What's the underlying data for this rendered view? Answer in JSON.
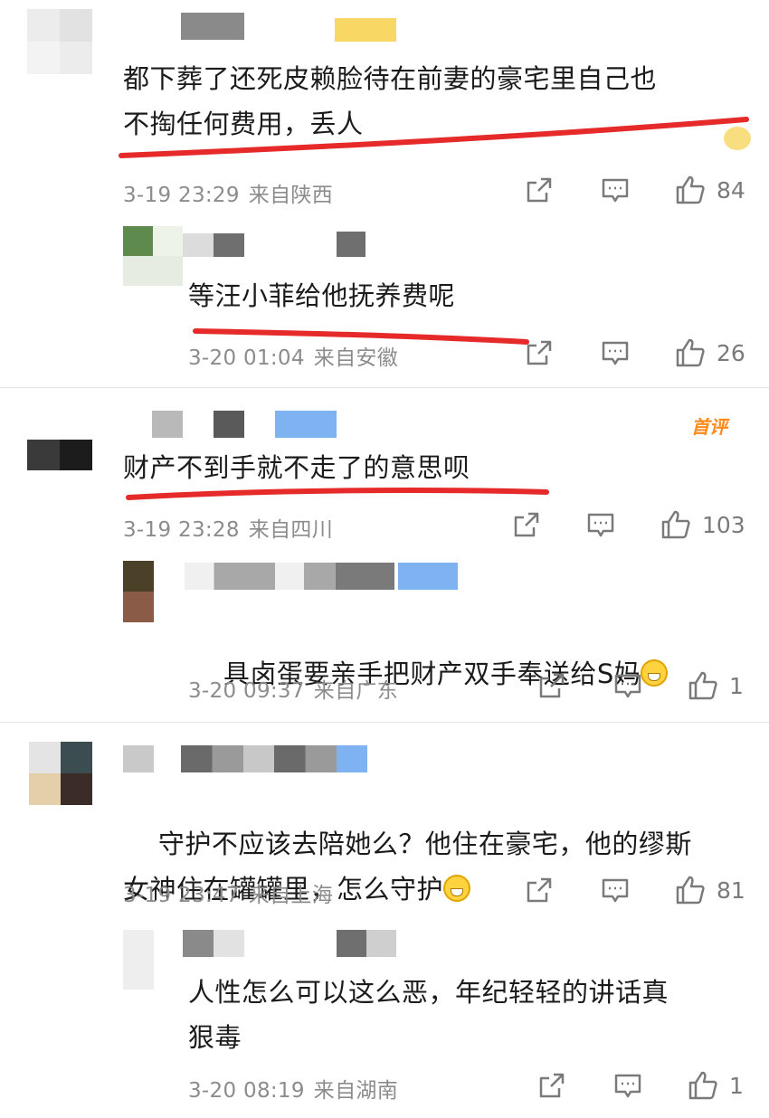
{
  "colors": {
    "underline": "#e62a2a",
    "meta_text": "#8c8c8c",
    "badge": "#ff8a1a",
    "vip_yellow": "#f7d049",
    "blue_name": "#7fb2f0"
  },
  "comments": [
    {
      "text": "都下葬了还死皮赖脸待在前妻的豪宅里自己也\n不掏任何费用，丢人",
      "time": "3-19 23:29",
      "location": "来自陕西",
      "likes": "84",
      "reply": {
        "text": "等汪小菲给他抚养费呢",
        "time": "3-20 01:04",
        "location": "来自安徽",
        "likes": "26"
      }
    },
    {
      "badge": "首评",
      "text": "财产不到手就不走了的意思呗",
      "time": "3-19 23:28",
      "location": "来自四川",
      "likes": "103",
      "reply": {
        "text": "具卤蛋要亲手把财产双手奉送给S妈",
        "time": "3-20 09:37",
        "location": "来自广东",
        "likes": "1"
      }
    },
    {
      "text": "守护不应该去陪她么？他住在豪宅，他的缪斯\n女神住在罐罐里，怎么守护",
      "time": "3-19 23:47",
      "location": "来自上海",
      "likes": "81",
      "reply": {
        "text": "人性怎么可以这么恶，年纪轻轻的讲话真\n狠毒",
        "time": "3-20 08:19",
        "location": "来自湖南",
        "likes": "1"
      }
    }
  ],
  "icons": {
    "share": "share-icon",
    "comment": "comment-icon",
    "like": "thumbs-up-icon",
    "laugh": "grin-emoji-icon"
  }
}
